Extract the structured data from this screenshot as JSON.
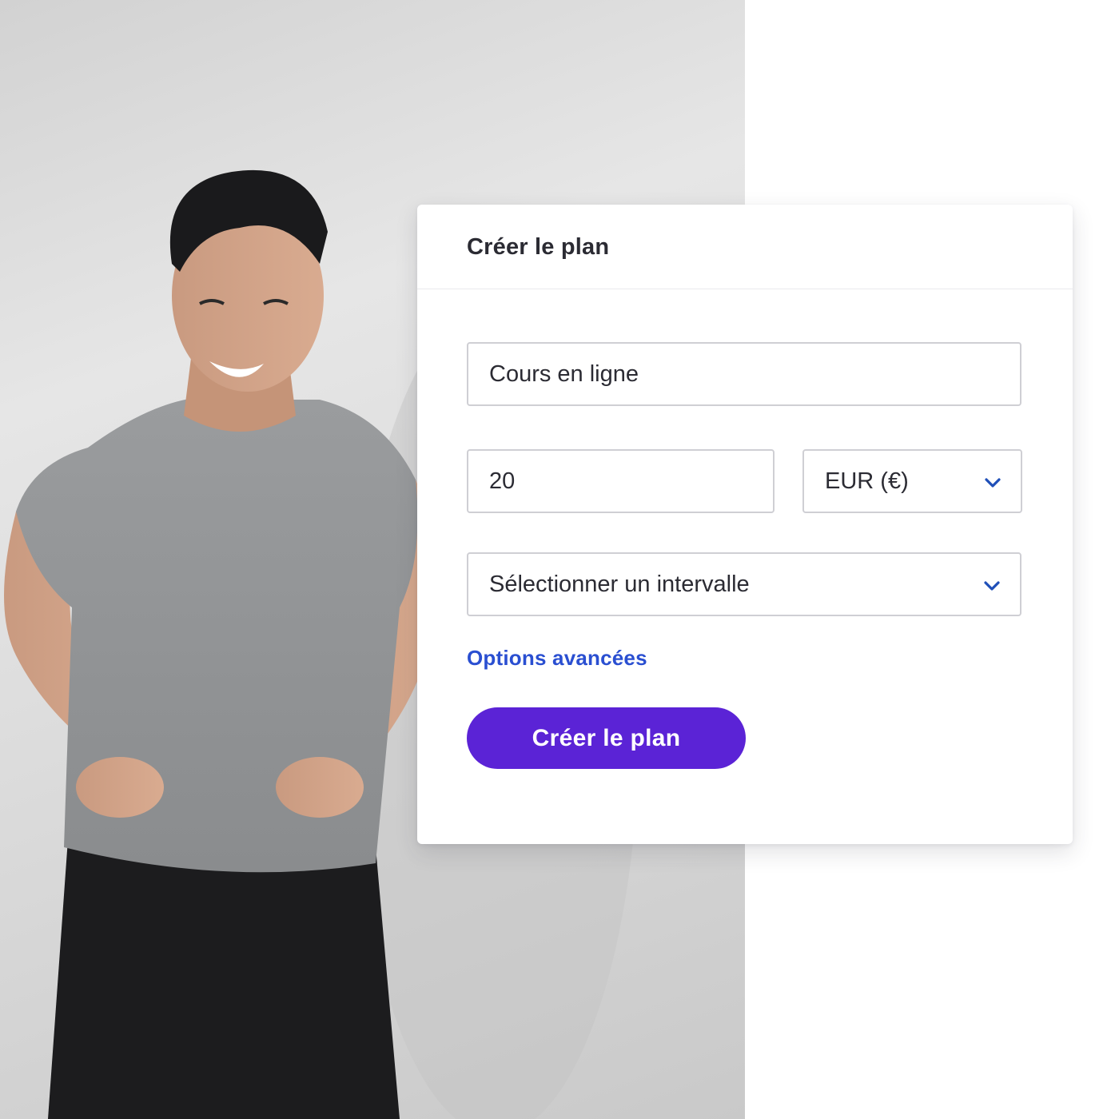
{
  "form": {
    "title": "Créer le plan",
    "plan_name_value": "Cours en ligne",
    "amount_value": "20",
    "currency_selected": "EUR (€)",
    "interval_placeholder": "Sélectionner un intervalle",
    "advanced_options_label": "Options avancées",
    "submit_label": "Créer le plan"
  },
  "icons": {
    "dropdown": "chevron-down-icon"
  },
  "colors": {
    "primary_button": "#5b23d6",
    "link": "#2a4fd1",
    "chevron": "#1f4fb8",
    "field_border": "#cfcfd4",
    "title_text": "#2b2b33"
  }
}
